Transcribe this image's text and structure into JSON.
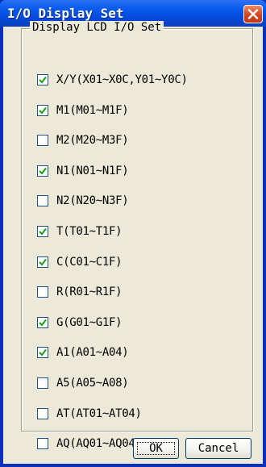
{
  "window": {
    "title": "I/O Display Set"
  },
  "group": {
    "label": "Display LCD I/O Set"
  },
  "items": [
    {
      "label": "X/Y(X01~X0C,Y01~Y0C)",
      "checked": true
    },
    {
      "label": "M1(M01~M1F)",
      "checked": true
    },
    {
      "label": "M2(M20~M3F)",
      "checked": false
    },
    {
      "label": "N1(N01~N1F)",
      "checked": true
    },
    {
      "label": "N2(N20~N3F)",
      "checked": false
    },
    {
      "label": "T(T01~T1F)",
      "checked": true
    },
    {
      "label": "C(C01~C1F)",
      "checked": true
    },
    {
      "label": "R(R01~R1F)",
      "checked": false
    },
    {
      "label": "G(G01~G1F)",
      "checked": true
    },
    {
      "label": "A1(A01~A04)",
      "checked": true
    },
    {
      "label": "A5(A05~A08)",
      "checked": false
    },
    {
      "label": "AT(AT01~AT04)",
      "checked": false
    },
    {
      "label": "AQ(AQ01~AQ04)",
      "checked": false
    }
  ],
  "buttons": {
    "ok": "OK",
    "cancel": "Cancel"
  },
  "colors": {
    "titlebar": "#0a5df2",
    "close": "#d6431f",
    "dialog_bg": "#ece9d8",
    "check": "#21a121"
  },
  "icons": {
    "close": "close-icon",
    "check": "checkmark-icon"
  }
}
